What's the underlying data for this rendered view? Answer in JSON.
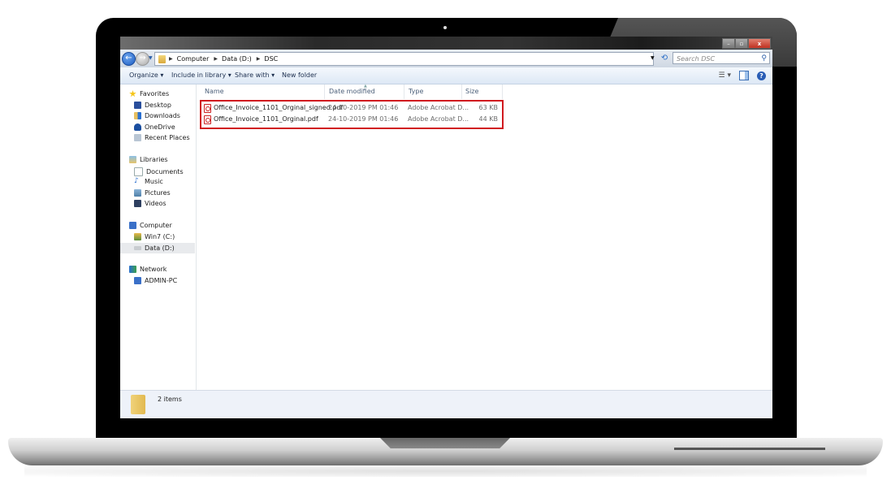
{
  "window": {
    "caption_buttons": {
      "minimize": "–",
      "maximize": "▫",
      "close": "x"
    }
  },
  "address_bar": {
    "breadcrumbs": [
      "Computer",
      "Data (D:)",
      "DSC"
    ],
    "search_placeholder": "Search DSC"
  },
  "toolbar": {
    "organize": "Organize ▾",
    "include_in_library": "Include in library ▾",
    "share_with": "Share with ▾",
    "new_folder": "New folder",
    "help": "?"
  },
  "sidebar": {
    "favorites": {
      "label": "Favorites",
      "items": [
        "Desktop",
        "Downloads",
        "OneDrive",
        "Recent Places"
      ]
    },
    "libraries": {
      "label": "Libraries",
      "items": [
        "Documents",
        "Music",
        "Pictures",
        "Videos"
      ]
    },
    "computer": {
      "label": "Computer",
      "items": [
        "Win7 (C:)",
        "Data (D:)"
      ],
      "selected": "Data (D:)"
    },
    "network": {
      "label": "Network",
      "items": [
        "ADMIN-PC"
      ]
    }
  },
  "file_list": {
    "columns": [
      "Name",
      "Date modified",
      "Type",
      "Size"
    ],
    "rows": [
      {
        "name": "Office_Invoice_1101_Orginal_signed.pdf",
        "date": "24-10-2019 PM 01:46",
        "type": "Adobe Acrobat D...",
        "size": "63 KB"
      },
      {
        "name": "Office_Invoice_1101_Orginal.pdf",
        "date": "24-10-2019 PM 01:46",
        "type": "Adobe Acrobat D...",
        "size": "44 KB"
      }
    ],
    "highlight_color": "#d01a1f"
  },
  "status": {
    "item_count": "2 items"
  }
}
